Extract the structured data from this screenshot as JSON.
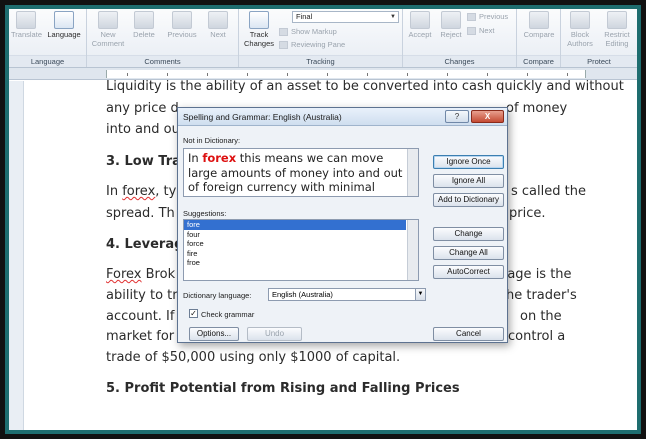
{
  "ribbon": {
    "groups": [
      {
        "label": "Language",
        "buttons": [
          "Translate",
          "Language"
        ]
      },
      {
        "label": "Comments",
        "buttons": [
          "New Comment",
          "Delete",
          "Previous",
          "Next"
        ]
      },
      {
        "label": "Tracking",
        "track_changes": "Track Changes",
        "markup_select": "Final",
        "show_markup": "Show Markup",
        "reviewing_pane": "Reviewing Pane"
      },
      {
        "label": "Changes",
        "buttons": [
          "Accept",
          "Reject"
        ],
        "previous": "Previous",
        "next": "Next"
      },
      {
        "label": "Compare",
        "buttons": [
          "Compare"
        ]
      },
      {
        "label": "Protect",
        "buttons": [
          "Block Authors",
          "Restrict Editing"
        ]
      }
    ]
  },
  "document": {
    "line1": "Liquidity is the ability of an asset to be converted into cash quickly and without",
    "line2a": "any price d",
    "line2b": "of money",
    "line3": "into and ou",
    "h3": "3. Low Tra",
    "p4a": "In ",
    "p4err": "forex",
    "p4b": ", ty",
    "p4c": "s called the",
    "p5a": "spread. Th",
    "p5b": "price.",
    "h4": "4. Leverage",
    "p6err": "Forex",
    "p6a": " Brok",
    "p6b": "erage is the",
    "p7a": "ability to tr",
    "p7b": "he trader's",
    "p8a": "account. If",
    "p8b": "on the",
    "p9a": "market for",
    "p9b": "control a",
    "p10": "trade of $50,000 using only $1000 of capital.",
    "h5": "5. Profit Potential from Rising and Falling Prices"
  },
  "dialog": {
    "title": "Spelling and Grammar: English (Australia)",
    "help": "?",
    "close": "X",
    "not_in_dictionary_label": "Not in Dictionary:",
    "sentence_before": "In ",
    "error_word": "forex",
    "sentence_after": " this means we can move large amounts of money into and out of foreign currency with minimal price movement.",
    "suggestions_label": "Suggestions:",
    "suggestions": [
      "fore",
      "four",
      "force",
      "fire",
      "froe"
    ],
    "dictionary_language_label": "Dictionary language:",
    "dictionary_language": "English (Australia)",
    "check_grammar_label": "Check grammar",
    "check_grammar_checked": "✓",
    "buttons": {
      "ignore_once": "Ignore Once",
      "ignore_all": "Ignore All",
      "add_to_dictionary": "Add to Dictionary",
      "change": "Change",
      "change_all": "Change All",
      "autocorrect": "AutoCorrect",
      "options": "Options...",
      "undo": "Undo",
      "cancel": "Cancel"
    }
  }
}
